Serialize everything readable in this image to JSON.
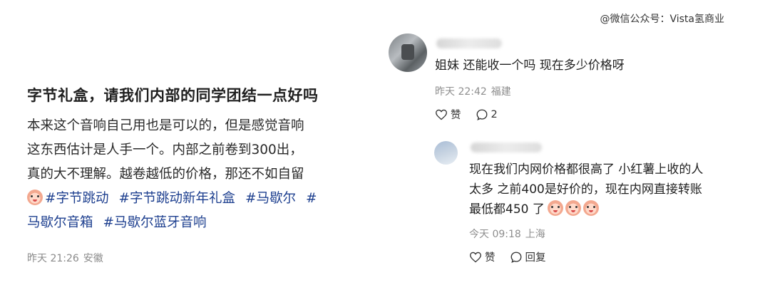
{
  "watermark": "@微信公众号：Vista氢商业",
  "post": {
    "title": "字节礼盒，请我们内部的同学团结一点好吗",
    "body_lines": [
      "本来这个音响自己用也是可以的，但是感觉音响",
      "这东西估计是人手一个。内部之前卷到300出，",
      "真的大不理解。越卷越低的价格，那还不如自留"
    ],
    "tags": [
      "#字节跳动",
      "#字节跳动新年礼盒",
      "#马歇尔",
      "#",
      "马歇尔音箱",
      "#马歇尔蓝牙音响"
    ],
    "time": "昨天 21:26",
    "location": "安徽"
  },
  "comments": [
    {
      "text": "姐妹 还能收一个吗 现在多少价格呀",
      "time": "昨天 22:42",
      "location": "福建",
      "like_label": "赞",
      "reply_count": "2"
    },
    {
      "text_lines": [
        "现在我们内网价格都很高了 小红薯上收的人",
        "太多 之前400是好价的，现在内网直接转账",
        "最低都450 了"
      ],
      "time": "今天 09:18",
      "location": "上海",
      "like_label": "赞",
      "reply_label": "回复"
    }
  ],
  "colors": {
    "tag": "#1d3f8f",
    "meta": "#8a8a8a",
    "text": "#222222"
  }
}
